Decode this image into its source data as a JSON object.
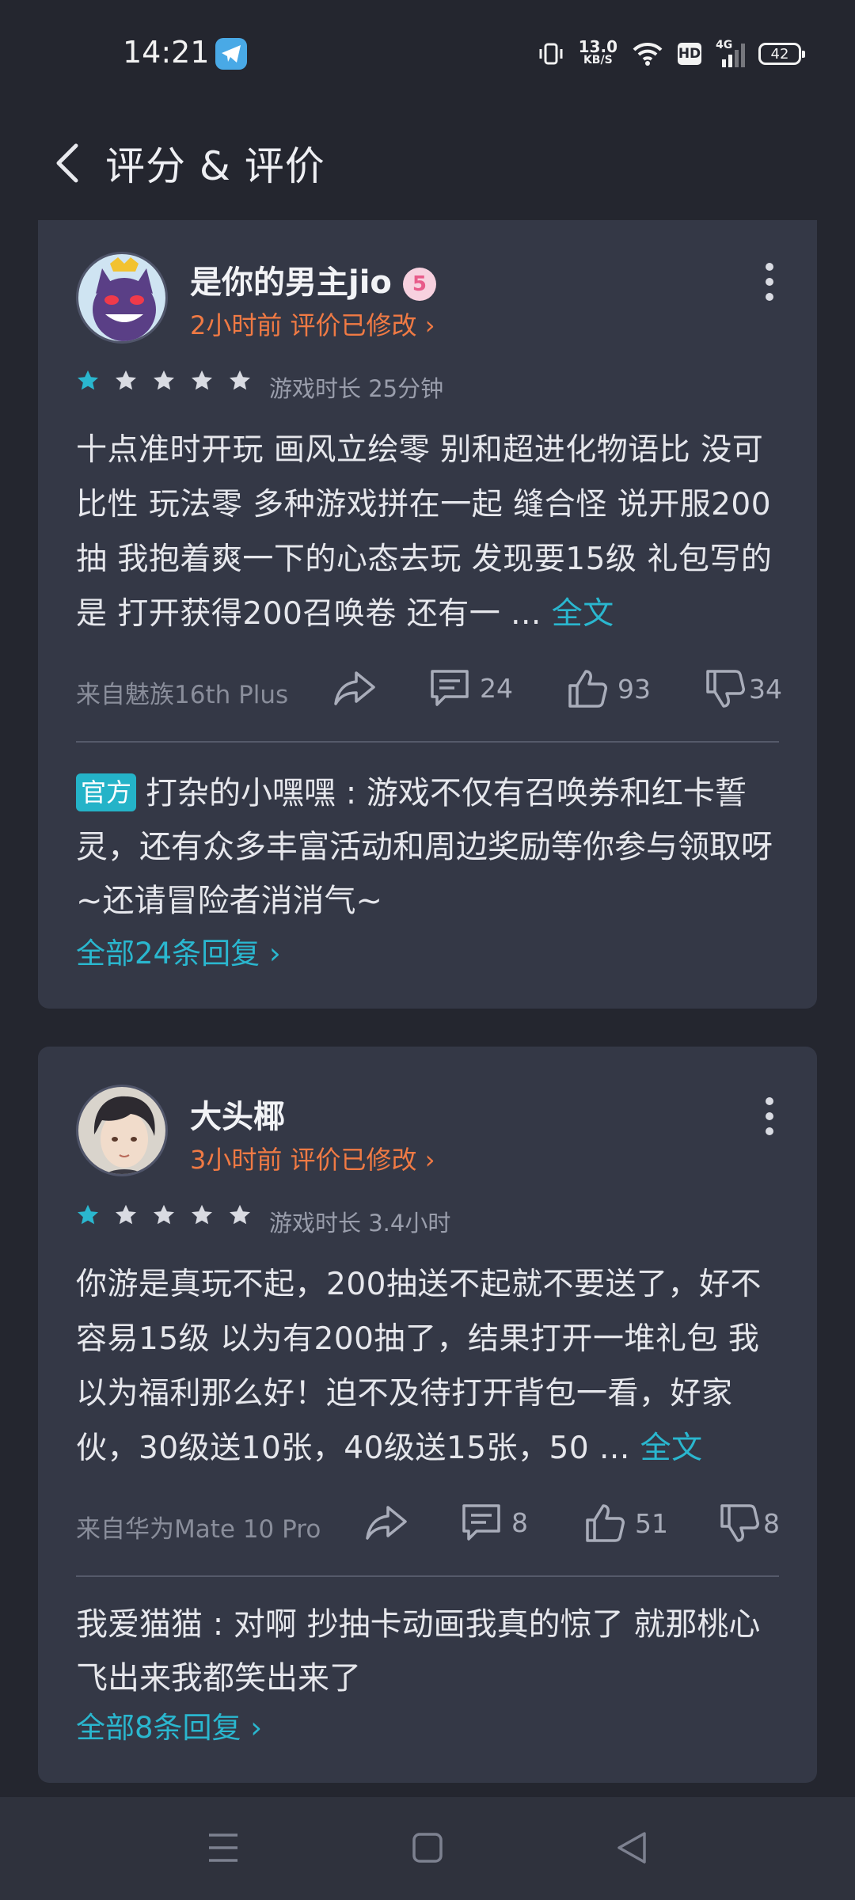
{
  "status_bar": {
    "time": "14:21",
    "net_speed_value": "13.0",
    "net_speed_unit": "KB/S",
    "hd_label": "HD",
    "signal_label": "4G",
    "battery": "42",
    "icons": [
      "telegram-icon",
      "vibrate-icon",
      "wifi-icon",
      "hd-icon",
      "signal-icon",
      "battery-icon"
    ]
  },
  "header": {
    "title": "评分 & 评价"
  },
  "reviews": [
    {
      "username": "是你的男主jio",
      "level_badge": "5",
      "meta": "2小时前  评价已修改 ›",
      "rating": 1,
      "playtime": "游戏时长 25分钟",
      "text": "十点准时开玩 画风立绘零 别和超进化物语比 没可比性 玩法零 多种游戏拼在一起 缝合怪 说开服200抽 我抱着爽一下的心态去玩 发现要15级 礼包写的是 打开获得200召唤卷 还有一 ... ",
      "more_label": "全文",
      "device": "来自魅族16th Plus",
      "comments": "24",
      "likes": "93",
      "dislikes": "34",
      "reply_tag": "官方",
      "reply_text": "打杂的小嘿嘿 : 游戏不仅有召唤券和红卡誓灵，还有众多丰富活动和周边奖励等你参与领取呀~还请冒险者消消气~",
      "all_replies": "全部24条回复 ›"
    },
    {
      "username": "大头椰",
      "meta": "3小时前  评价已修改 ›",
      "rating": 1,
      "playtime": "游戏时长 3.4小时",
      "text": "你游是真玩不起，200抽送不起就不要送了，好不容易15级 以为有200抽了，结果打开一堆礼包 我以为福利那么好！迫不及待打开背包一看，好家伙，30级送10张，40级送15张，50 ... ",
      "more_label": "全文",
      "device": "来自华为Mate 10 Pro",
      "comments": "8",
      "likes": "51",
      "dislikes": "8",
      "reply_text": "我爱猫猫 : 对啊 抄抽卡动画我真的惊了 就那桃心飞出来我都笑出来了",
      "all_replies": "全部8条回复 ›"
    }
  ],
  "colors": {
    "background": "#24262f",
    "card": "#343846",
    "accent": "#2ab7cf",
    "meta_orange": "#f07a44",
    "star_filled": "#2ab7cf",
    "star_empty": "#d9dbe2"
  }
}
